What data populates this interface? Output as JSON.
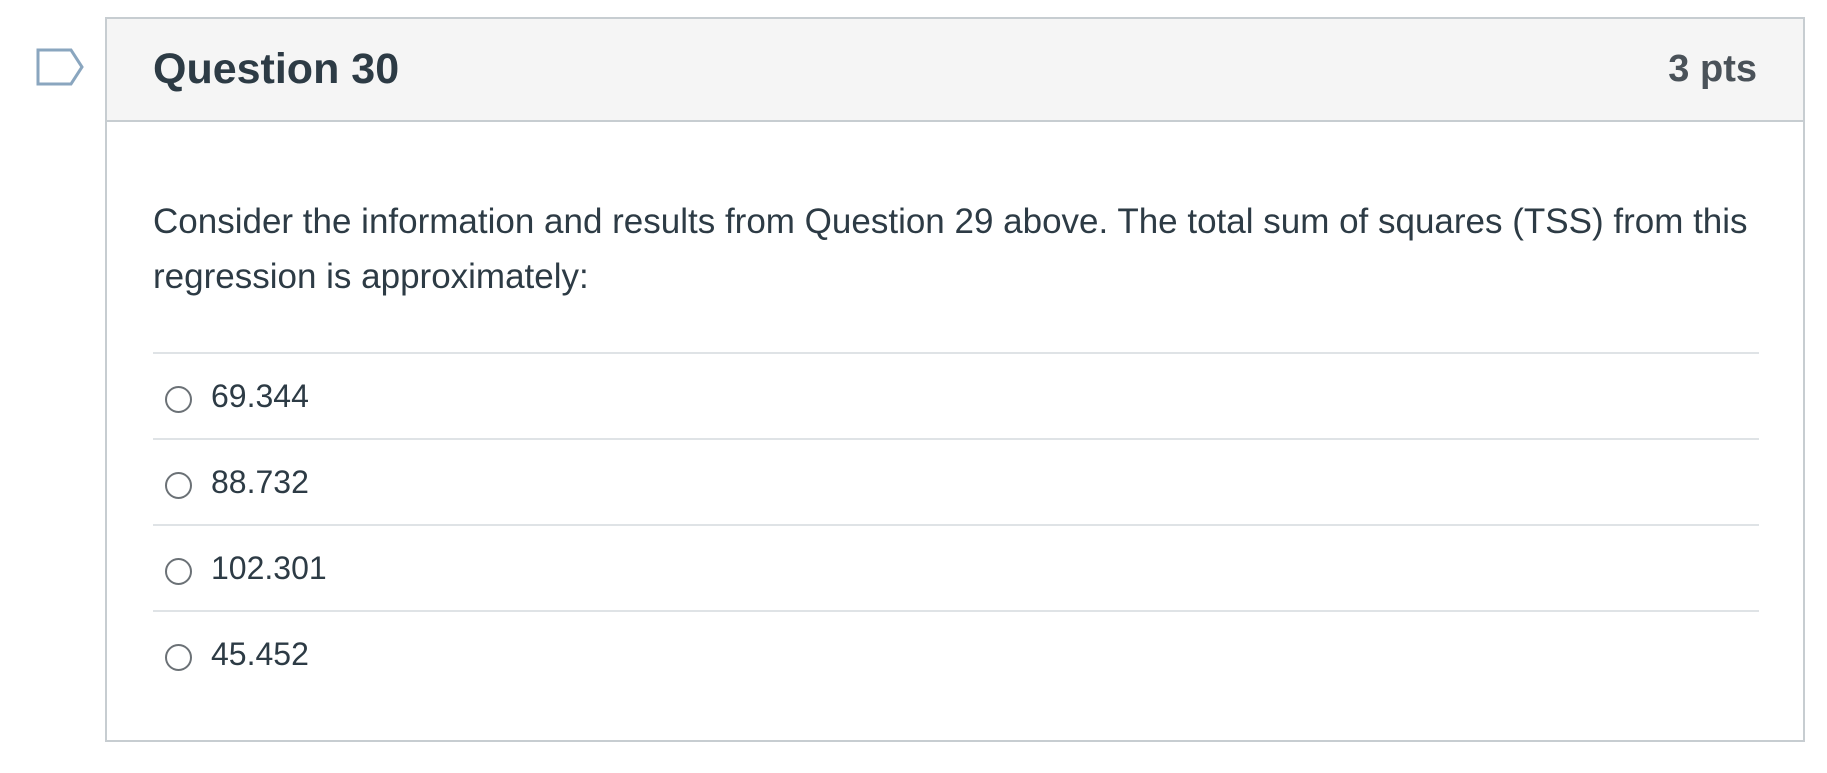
{
  "flag": {
    "icon": "bookmark-flag-icon",
    "color": "#8aa6bf"
  },
  "question": {
    "title": "Question 30",
    "points": "3 pts",
    "text": "Consider the information and results from Question 29 above.  The total sum of squares (TSS) from this regression is approximately:",
    "answers": [
      {
        "label": "69.344",
        "selected": false
      },
      {
        "label": "88.732",
        "selected": false
      },
      {
        "label": "102.301",
        "selected": false
      },
      {
        "label": "45.452",
        "selected": false
      }
    ]
  }
}
